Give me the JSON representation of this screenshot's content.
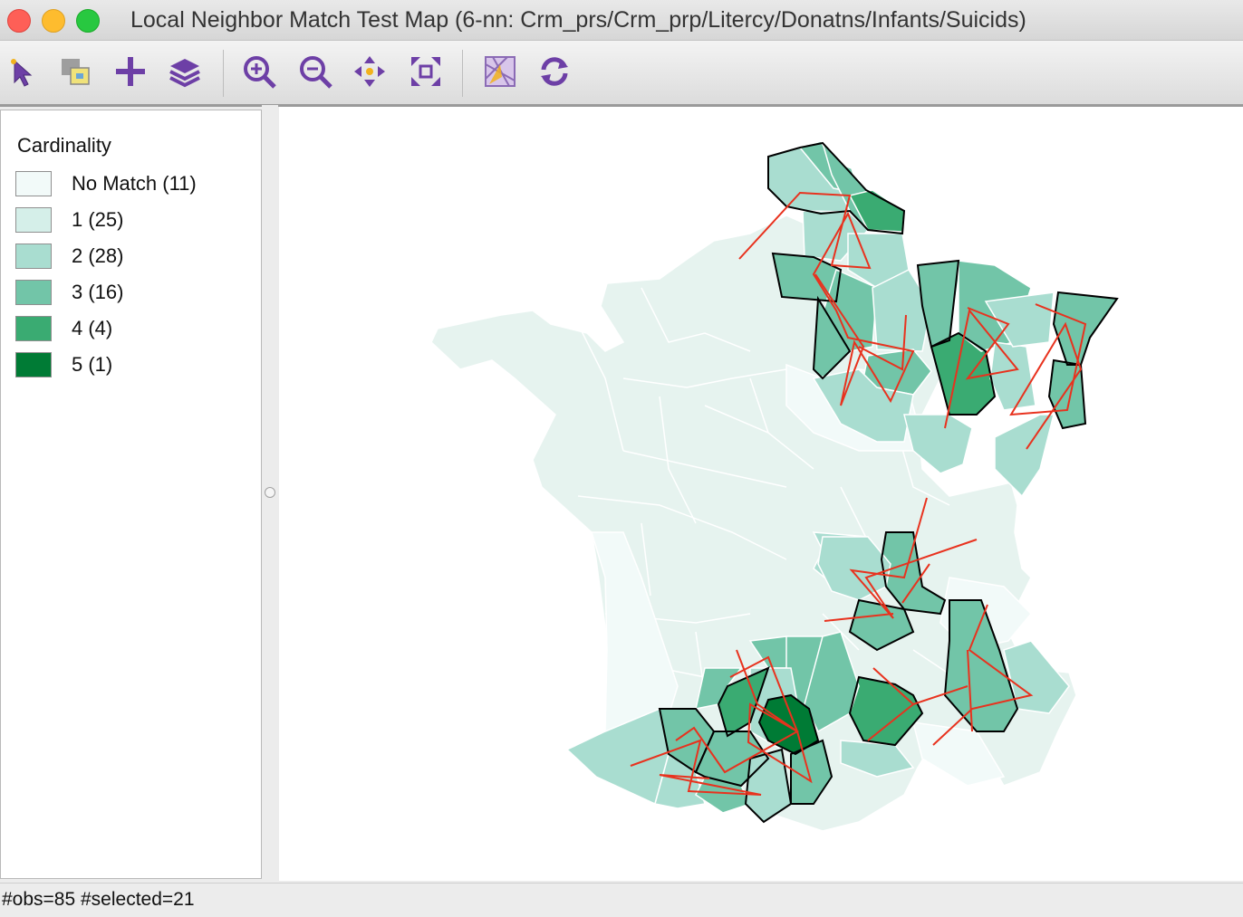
{
  "window": {
    "title": "Local Neighbor Match Test Map (6-nn: Crm_prs/Crm_prp/Litercy/Donatns/Infants/Suicids)"
  },
  "toolbar": {
    "tools": [
      {
        "icon": "select-pointer-icon"
      },
      {
        "icon": "selection-shape-icon"
      },
      {
        "icon": "add-layer-icon"
      },
      {
        "icon": "layers-icon"
      },
      {
        "icon": "zoom-in-icon"
      },
      {
        "icon": "zoom-out-icon"
      },
      {
        "icon": "pan-icon"
      },
      {
        "icon": "fit-extent-icon"
      },
      {
        "icon": "basemap-icon"
      },
      {
        "icon": "refresh-icon"
      }
    ]
  },
  "legend": {
    "title": "Cardinality",
    "items": [
      {
        "label": "No Match (11)",
        "color": "#f2faf9"
      },
      {
        "label": "1 (25)",
        "color": "#d5efe9"
      },
      {
        "label": "2 (28)",
        "color": "#a9ddd0"
      },
      {
        "label": "3 (16)",
        "color": "#72c5a8"
      },
      {
        "label": "4 (4)",
        "color": "#3aab72"
      },
      {
        "label": "5 (1)",
        "color": "#007b35"
      }
    ]
  },
  "map": {
    "colors": {
      "base_region": "#e6f3ef",
      "region_stroke": "#ffffff",
      "selected_outline": "#000000",
      "connection_line": "#e8321e"
    }
  },
  "status": {
    "text": "#obs=85 #selected=21"
  }
}
